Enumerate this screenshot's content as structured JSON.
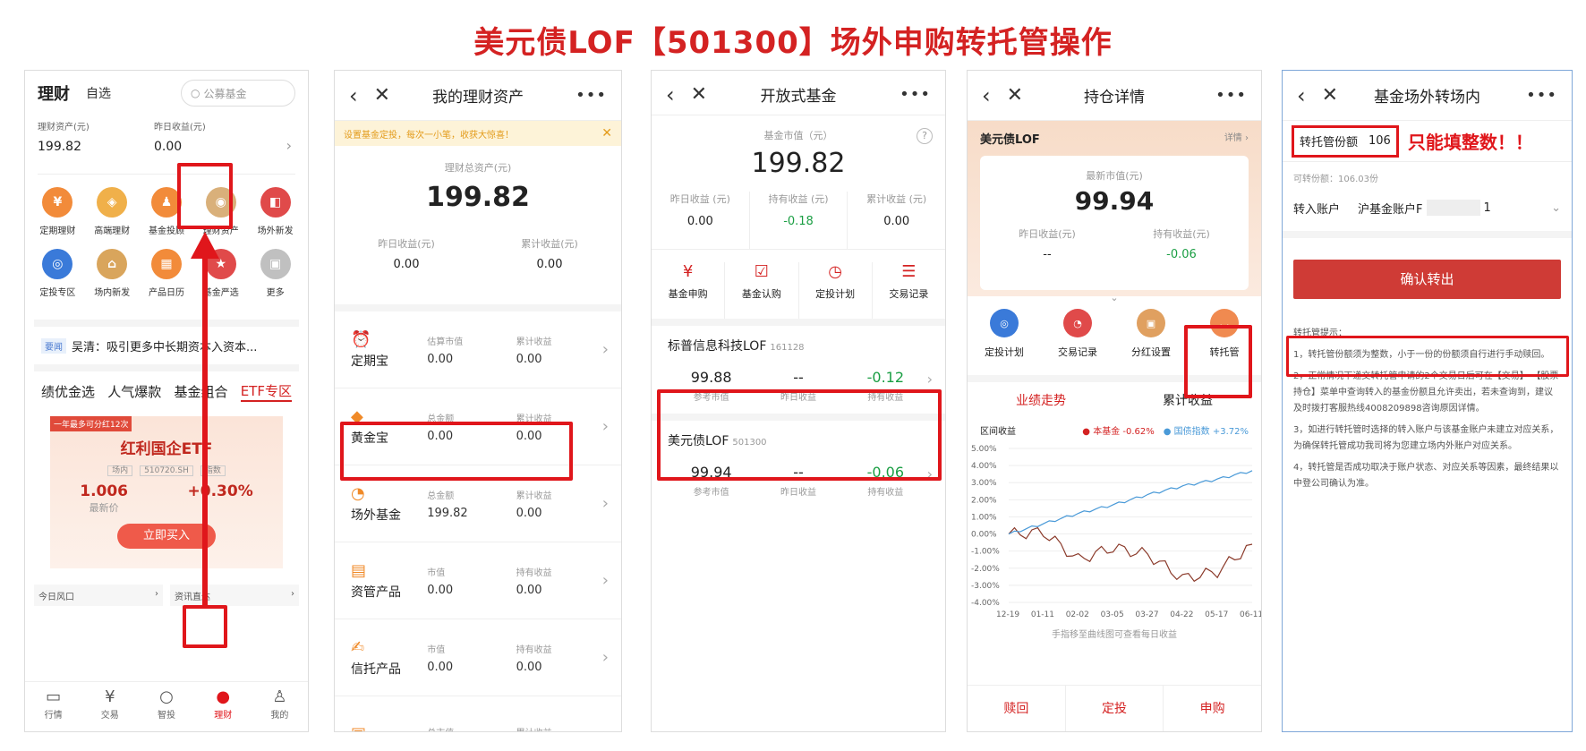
{
  "banner": {
    "title": "美元债LOF【501300】场外申购转托管操作"
  },
  "p1": {
    "title": "理财",
    "fav": "自选",
    "search_placeholder": "公募基金",
    "asset_label": "理财资产(元)",
    "asset_value": "199.82",
    "yday_label": "昨日收益(元)",
    "yday_value": "0.00",
    "icons_row1": [
      "定期理财",
      "高端理财",
      "基金投顾",
      "理财资产",
      "场外新发"
    ],
    "icons_row2": [
      "定投专区",
      "场内新发",
      "产品日历",
      "基金严选",
      "更多"
    ],
    "news_tag": "要闻",
    "news_text": "吴清：吸引更多中长期资本入资本...",
    "tabs": [
      "绩优金选",
      "人气爆款",
      "基金组合",
      "ETF专区"
    ],
    "promo_tag": "一年最多可分红12次",
    "etf_name": "红利国企ETF",
    "etf_tags": [
      "场内",
      "510720.SH",
      "指数"
    ],
    "etf_price": "1.006",
    "etf_price_label": "最新价",
    "etf_change": "+0.30%",
    "buy_btn": "立即买入",
    "mini_left": "今日风口",
    "mini_right": "资讯直达",
    "bottom": [
      "行情",
      "交易",
      "智投",
      "理财",
      "我的"
    ]
  },
  "p2": {
    "title": "我的理财资产",
    "notice": "设置基金定投，每次一小笔，收获大惊喜！",
    "total_label": "理财总资产(元)",
    "total_value": "199.82",
    "yday_label": "昨日收益(元)",
    "yday_value": "0.00",
    "cum_label": "累计收益(元)",
    "cum_value": "0.00",
    "rows": [
      {
        "name": "定期宝",
        "l1": "估算市值",
        "v1": "0.00",
        "l2": "累计收益",
        "v2": "0.00"
      },
      {
        "name": "黄金宝",
        "l1": "总金额",
        "v1": "0.00",
        "l2": "累计收益",
        "v2": "0.00"
      },
      {
        "name": "场外基金",
        "l1": "总金额",
        "v1": "199.82",
        "l2": "累计收益",
        "v2": "0.00"
      },
      {
        "name": "资管产品",
        "l1": "市值",
        "v1": "0.00",
        "l2": "持有收益",
        "v2": "0.00"
      },
      {
        "name": "信托产品",
        "l1": "市值",
        "v1": "0.00",
        "l2": "持有收益",
        "v2": "0.00"
      },
      {
        "name": "",
        "l1": "总市值",
        "v1": "",
        "l2": "累计收益",
        "v2": ""
      }
    ]
  },
  "p3": {
    "title": "开放式基金",
    "mv_label": "基金市值（元）",
    "mv_value": "199.82",
    "stats": [
      {
        "label": "昨日收益 (元)",
        "value": "0.00"
      },
      {
        "label": "持有收益 (元)",
        "value": "-0.18"
      },
      {
        "label": "累计收益 (元)",
        "value": "0.00"
      }
    ],
    "actions": [
      "基金申购",
      "基金认购",
      "定投计划",
      "交易记录"
    ],
    "funds": [
      {
        "name": "标普信息科技LOF",
        "code": "161128",
        "mv": "99.88",
        "yday": "--",
        "hold": "-0.12"
      },
      {
        "name": "美元债LOF",
        "code": "501300",
        "mv": "99.94",
        "yday": "--",
        "hold": "-0.06"
      }
    ],
    "col_labels": [
      "参考市值",
      "昨日收益",
      "持有收益"
    ]
  },
  "p4": {
    "title": "持仓详情",
    "fund": "美元债LOF",
    "detail": "详情",
    "mv_label": "最新市值(元)",
    "mv_value": "99.94",
    "yday_label": "昨日收益(元)",
    "yday_value": "--",
    "hold_label": "持有收益(元)",
    "hold_value": "-0.06",
    "actions": [
      "定投计划",
      "交易记录",
      "分红设置",
      "转托管"
    ],
    "tabs": [
      "业绩走势",
      "累计收益"
    ],
    "legend_label": "区间收益",
    "legend_fund": "本基金 -0.62%",
    "legend_index": "国债指数 +3.72%",
    "hint": "手指移至曲线图可查看每日收益",
    "bottom": [
      "赎回",
      "定投",
      "申购"
    ]
  },
  "p5": {
    "title": "基金场外转场内",
    "qty_label": "转托管份额",
    "qty_value": "106",
    "warning": "只能填整数！！",
    "avail": "可转份额：106.03份",
    "acct_label": "转入账户",
    "acct_value": "沪基金账户F",
    "acct_tail": "1",
    "confirm": "确认转出",
    "tips_title": "转托管提示：",
    "tips": [
      "1，转托管份额须为整数，小于一份的份额须自行进行手动赎回。",
      "2，正常情况下递交转托管申请的2个交易日后可在【交易】-【股票持仓】菜单中查询转入的基金份额且允许卖出，若未查询到，建议及时拨打客服热线4008209898咨询原因详情。",
      "3，如进行转托管时选择的转入账户与该基金账户未建立对应关系，为确保转托管成功我司将为您建立场内外账户对应关系。",
      "4，转托管是否成功取决于账户状态、对应关系等因素，最终结果以中登公司确认为准。"
    ]
  },
  "chart_data": {
    "type": "line",
    "title": "",
    "xlabel": "",
    "ylabel": "",
    "x": [
      "12-19",
      "01-11",
      "02-02",
      "03-05",
      "03-27",
      "04-22",
      "05-17",
      "06-11"
    ],
    "ylim": [
      -4.0,
      5.0
    ],
    "yticks": [
      "5.00%",
      "4.00%",
      "3.00%",
      "2.00%",
      "1.00%",
      "0.00%",
      "-1.00%",
      "-2.00%",
      "-3.00%",
      "-4.00%"
    ],
    "series": [
      {
        "name": "本基金",
        "color": "#8b3a2a",
        "values": [
          0.0,
          0.1,
          -1.5,
          -0.8,
          -1.2,
          -2.6,
          -2.2,
          -0.6
        ]
      },
      {
        "name": "国债指数",
        "color": "#4a9ad8",
        "values": [
          0.0,
          0.6,
          1.2,
          1.7,
          2.3,
          2.8,
          3.2,
          3.7
        ]
      }
    ],
    "grid": true,
    "legend": "top"
  }
}
